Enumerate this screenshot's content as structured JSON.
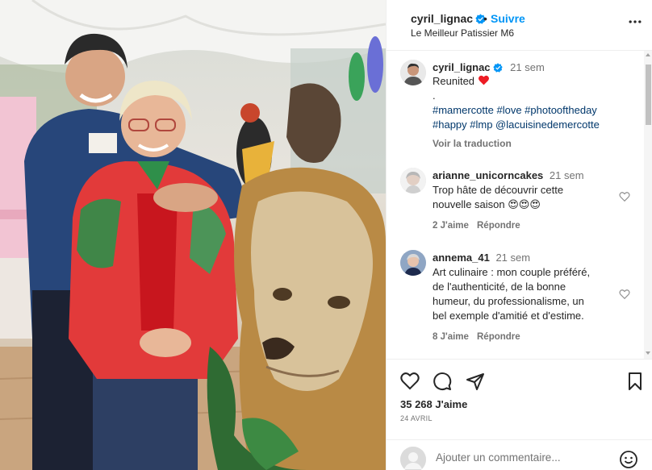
{
  "post": {
    "author": "cyril_lignac",
    "follow_label": "Suivre",
    "separator": "•",
    "subtitle": "Le Meilleur Patissier M6",
    "caption": {
      "author": "cyril_lignac",
      "time": "21 sem",
      "text": "Reunited",
      "dot": ".",
      "hashtags_line1": "#mamercotte #love #photooftheday",
      "hashtags_line2": "#happy #lmp @lacuisinedemercotte",
      "translate": "Voir la traduction"
    },
    "comments": [
      {
        "author": "arianne_unicorncakes",
        "time": "21 sem",
        "line1": "Trop hâte de découvrir cette",
        "line2": "nouvelle saison 😍😍😍",
        "likes": "2 J'aime",
        "reply": "Répondre"
      },
      {
        "author": "annema_41",
        "time": "21 sem",
        "line1": "Art culinaire : mon couple préféré,",
        "line2": "de l'authenticité, de la bonne",
        "line3": "humeur, du professionalisme, un",
        "line4": "bel exemple d'amitié et d'estime.",
        "likes": "8 J'aime",
        "reply": "Répondre"
      }
    ],
    "likes": "35 268 J'aime",
    "date": "24 AVRIL",
    "add_comment_placeholder": "Ajouter un commentaire..."
  },
  "colors": {
    "accent": "#0095f6",
    "verified": "#0095f6",
    "heart": "#ed1c24",
    "hashtag": "#00376b",
    "muted": "#737373"
  },
  "icons": {
    "more": "more-horizontal-icon",
    "like": "heart-icon",
    "comment": "comment-icon",
    "share": "send-icon",
    "save": "bookmark-icon",
    "emoji": "emoji-icon"
  }
}
